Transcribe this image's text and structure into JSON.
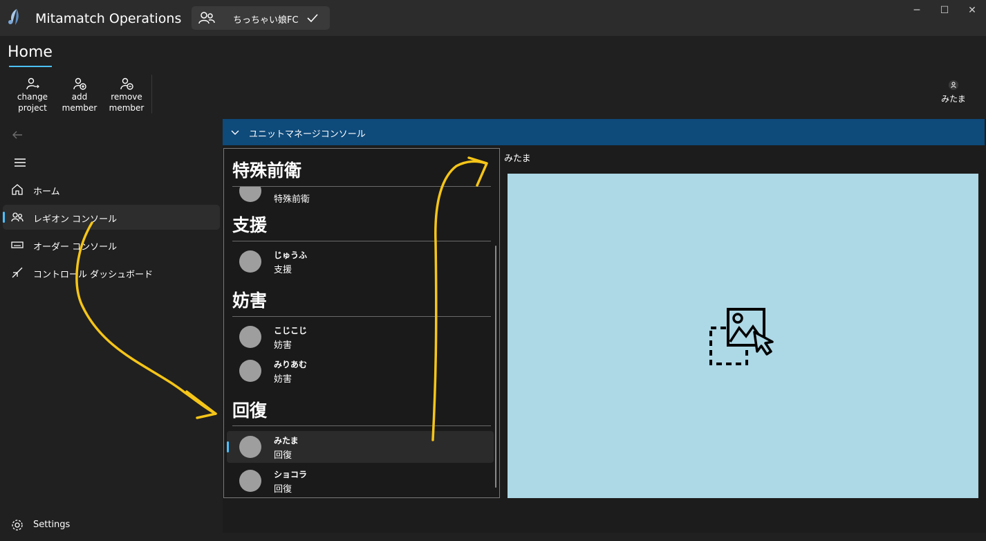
{
  "titlebar": {
    "app_title": "Mitamatch Operations",
    "project_name": "ちっちゃい娘FC",
    "minimize": "─",
    "maximize": "☐",
    "close": "✕"
  },
  "header": {
    "page_title": "Home"
  },
  "commands": {
    "change_project": [
      "change",
      "project"
    ],
    "add_member": [
      "add",
      "member"
    ],
    "remove_member": [
      "remove",
      "member"
    ]
  },
  "user": {
    "name": "みたま"
  },
  "nav": {
    "items": [
      {
        "label": "ホーム",
        "icon": "home-icon"
      },
      {
        "label": "レギオン コンソール",
        "icon": "people-icon",
        "selected": true
      },
      {
        "label": "オーダー コンソール",
        "icon": "keyboard-icon"
      },
      {
        "label": "コントロール ダッシュボード",
        "icon": "pen-icon"
      }
    ],
    "settings_label": "Settings"
  },
  "expander": {
    "title": "ユニットマネージコンソール"
  },
  "groups": [
    {
      "title": "特殊前衛",
      "members": [
        {
          "name": "",
          "role": "特殊前衛"
        }
      ]
    },
    {
      "title": "支援",
      "members": [
        {
          "name": "じゅうふ",
          "role": "支援"
        }
      ]
    },
    {
      "title": "妨害",
      "members": [
        {
          "name": "こじこじ",
          "role": "妨害"
        },
        {
          "name": "みりあむ",
          "role": "妨害"
        }
      ]
    },
    {
      "title": "回復",
      "members": [
        {
          "name": "みたま",
          "role": "回復",
          "selected": true
        },
        {
          "name": "ショコラ",
          "role": "回復"
        }
      ]
    }
  ],
  "detail": {
    "name": "みたま",
    "image_icon": "image-placeholder-icon"
  },
  "colors": {
    "accent": "#4cc2ff",
    "expander_header": "#0e4a7a",
    "image_background": "#add8e6",
    "annotation_arrow": "#f5c518"
  }
}
